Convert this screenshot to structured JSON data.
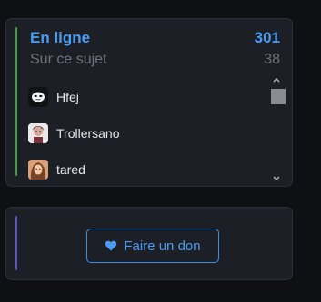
{
  "online_widget": {
    "title_label": "En ligne",
    "title_count": "301",
    "subtitle_label": "Sur ce sujet",
    "subtitle_count": "38",
    "accent_color": "#3aa33a",
    "title_color": "#4b9cf0",
    "users": [
      {
        "name": "Hfej",
        "avatar": "mask-avatar"
      },
      {
        "name": "Trollersano",
        "avatar": "photo-avatar"
      },
      {
        "name": "tared",
        "avatar": "photo-avatar"
      }
    ]
  },
  "donate_widget": {
    "accent_color": "#5a4fd6",
    "button_label": "Faire un don",
    "button_icon": "heart-icon"
  }
}
